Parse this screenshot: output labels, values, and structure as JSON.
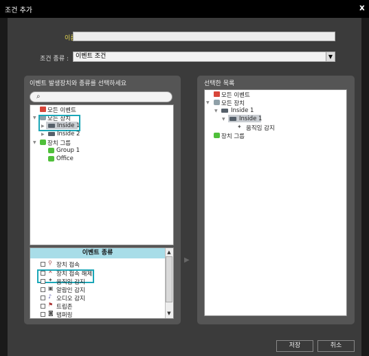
{
  "window": {
    "title": "조건 추가",
    "close": "x"
  },
  "form": {
    "name_label": "이름 :",
    "name_value": "",
    "condition_label": "조건 종류 :",
    "condition_value": "이벤트 조건"
  },
  "left_panel": {
    "title": "이벤트 발생장치와 종류를 선택하세요",
    "search_placeholder": "",
    "tree": {
      "all_events": "모든 이벤트",
      "all_devices": "모든 장치",
      "inside1": "Inside 1",
      "inside2": "Inside 2",
      "device_group": "장치 그룹",
      "group1": "Group 1",
      "office": "Office"
    }
  },
  "event_types": {
    "header": "이벤트 종류",
    "items": [
      "장치 접속",
      "장치 접속 해제",
      "움직임 감지",
      "알람인 감지",
      "오디오 감지",
      "트립존",
      "탬퍼링"
    ]
  },
  "right_panel": {
    "title": "선택한 목록",
    "tree": {
      "all_events": "모든 이벤트",
      "all_devices": "모든 장치",
      "inside1_parent": "Inside 1",
      "inside1_child": "Inside 1",
      "motion": "움직임 감지",
      "device_group": "장치 그룹"
    }
  },
  "buttons": {
    "save": "저장",
    "cancel": "취소"
  },
  "colors": {
    "highlight": "#1aa6b7",
    "name_label": "#e6d84f",
    "event_header": "#a8dde8"
  }
}
